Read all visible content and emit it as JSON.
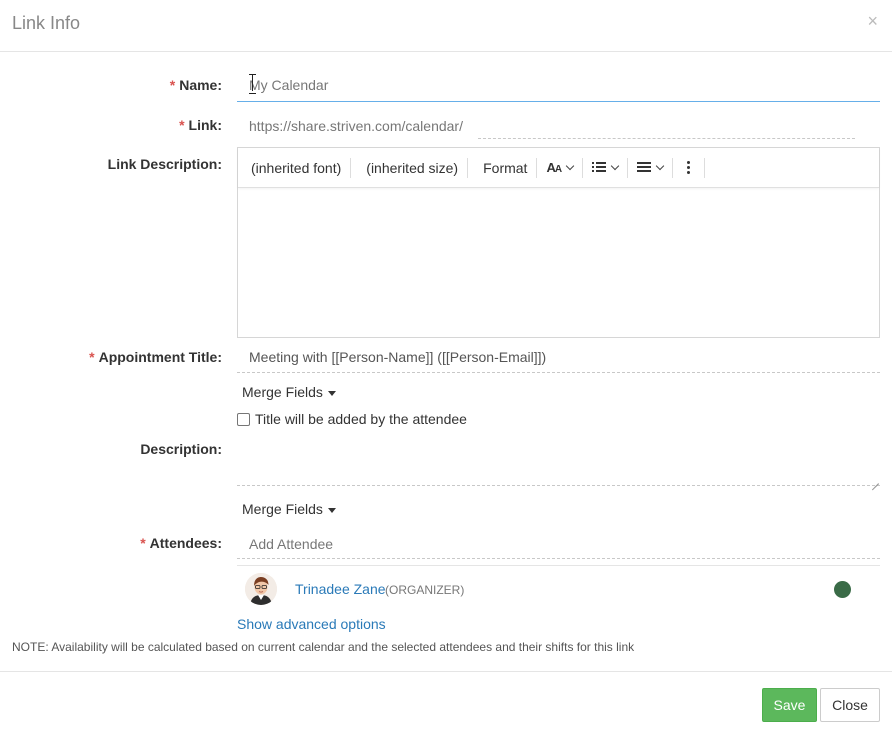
{
  "header": {
    "title": "Link Info",
    "close_glyph": "×"
  },
  "form": {
    "required_mark": "*",
    "name": {
      "label": "Name:",
      "value": "My Calendar"
    },
    "link": {
      "label": "Link:",
      "value": "https://share.striven.com/calendar/"
    },
    "link_description": {
      "label": "Link Description:",
      "toolbar": {
        "font": "(inherited font)",
        "size": "(inherited size)",
        "format": "Format",
        "text_style_icon": "font-size-icon",
        "list_icon": "bulleted-list-icon",
        "align_icon": "align-icon",
        "more_icon": "more-vertical-icon"
      },
      "value": ""
    },
    "appointment_title": {
      "label": "Appointment Title:",
      "value": "Meeting with [[Person-Name]] ([[Person-Email]])"
    },
    "merge_fields_label": "Merge Fields",
    "title_by_attendee": {
      "label": "Title will be added by the attendee",
      "checked": false
    },
    "description": {
      "label": "Description:",
      "value": ""
    },
    "attendees": {
      "label": "Attendees:",
      "placeholder": "Add Attendee",
      "list": [
        {
          "name": "Trinadee Zane",
          "role": "(ORGANIZER)",
          "status_color": "#3a6b47"
        }
      ]
    },
    "advanced_link": "Show advanced options",
    "note": "NOTE: Availability will be calculated based on current calendar and the selected attendees and their shifts for this link"
  },
  "footer": {
    "save_label": "Save",
    "close_label": "Close"
  },
  "colors": {
    "accent": "#2a7ab8",
    "save": "#5cb85c",
    "required": "#d9534f"
  }
}
